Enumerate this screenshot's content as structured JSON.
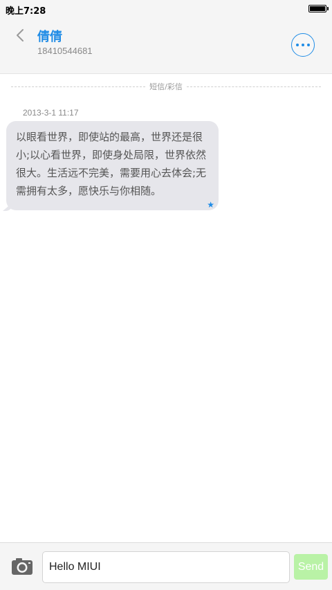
{
  "status_bar": {
    "time": "晚上7:28",
    "battery_level": 1.0
  },
  "header": {
    "contact_name": "倩倩",
    "contact_number": "18410544681",
    "back_icon": "chevron-left-icon",
    "more_icon": "more-dots-icon"
  },
  "conversation": {
    "divider_label": "短信/彩信",
    "messages": [
      {
        "timestamp": "2013-3-1 11:17",
        "text": "以眼看世界，即使站的最高，世界还是很小;以心看世界，即使身处局限，世界依然很大。生活远不完美，需要用心去体会;无需拥有太多，愿快乐与你相随。",
        "starred": true,
        "direction": "incoming"
      }
    ]
  },
  "input_bar": {
    "camera_icon": "camera-icon",
    "message_value": "Hello MIUI",
    "send_label": "Send"
  },
  "colors": {
    "accent": "#1f8ce6",
    "bubble": "#e6e6eb",
    "send_button": "#b9f2a6"
  }
}
